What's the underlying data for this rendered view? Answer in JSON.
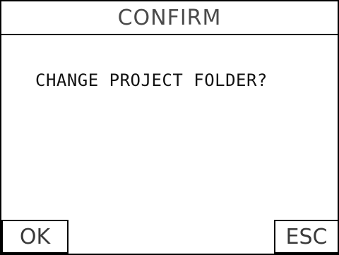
{
  "dialog": {
    "title": "CONFIRM",
    "message": "CHANGE PROJECT FOLDER?",
    "ok_label": "OK",
    "esc_label": "ESC"
  },
  "colors": {
    "background": "#ffffff",
    "border": "#000000",
    "title_text": "#4a4a4a",
    "button_text": "#3a3a3a"
  }
}
